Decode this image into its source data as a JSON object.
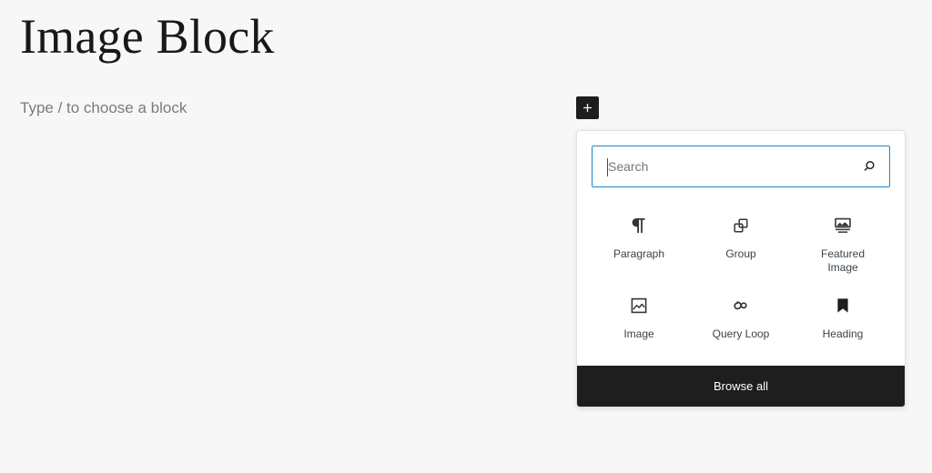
{
  "editor": {
    "title": "Image Block",
    "empty_paragraph_placeholder": "Type / to choose a block"
  },
  "inserter": {
    "toggle_label": "+",
    "toggle_icon": "plus-icon",
    "search": {
      "placeholder": "Search",
      "value": "",
      "icon": "search-icon"
    },
    "blocks": [
      {
        "label": "Paragraph",
        "icon": "paragraph-icon"
      },
      {
        "label": "Group",
        "icon": "group-icon"
      },
      {
        "label": "Featured Image",
        "icon": "featured-image-icon"
      },
      {
        "label": "Image",
        "icon": "image-icon"
      },
      {
        "label": "Query Loop",
        "icon": "query-loop-icon"
      },
      {
        "label": "Heading",
        "icon": "heading-icon"
      }
    ],
    "browse_all_label": "Browse all"
  },
  "colors": {
    "canvas_background": "#f7f7f7",
    "panel_background": "#ffffff",
    "panel_border": "#e0e0e0",
    "accent_focus": "#1e86c7",
    "dark": "#1e1e1e",
    "text_primary": "#16181a",
    "text_muted": "#7b7b7b"
  }
}
